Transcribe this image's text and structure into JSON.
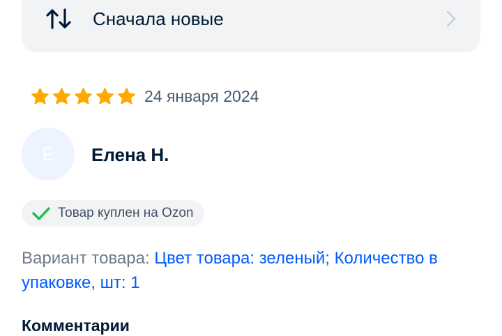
{
  "sort": {
    "label": "Сначала новые",
    "icon": "sort-arrows-icon",
    "chevron": "chevron-right-icon"
  },
  "review": {
    "rating": 5,
    "rating_max": 5,
    "date": "24 января 2024",
    "author_initial": "Е",
    "author_name": "Елена Н.",
    "verified_label": "Товар куплен на Ozon",
    "variant_label": "Вариант товара: ",
    "variant_value": "Цвет товара: зеленый; Количество в упаковке, шт: 1",
    "comment_heading": "Комментарии"
  },
  "colors": {
    "star": "#ffa800",
    "accent": "#005bff",
    "check": "#10c44c",
    "chip_bg": "#f2f3f5"
  }
}
